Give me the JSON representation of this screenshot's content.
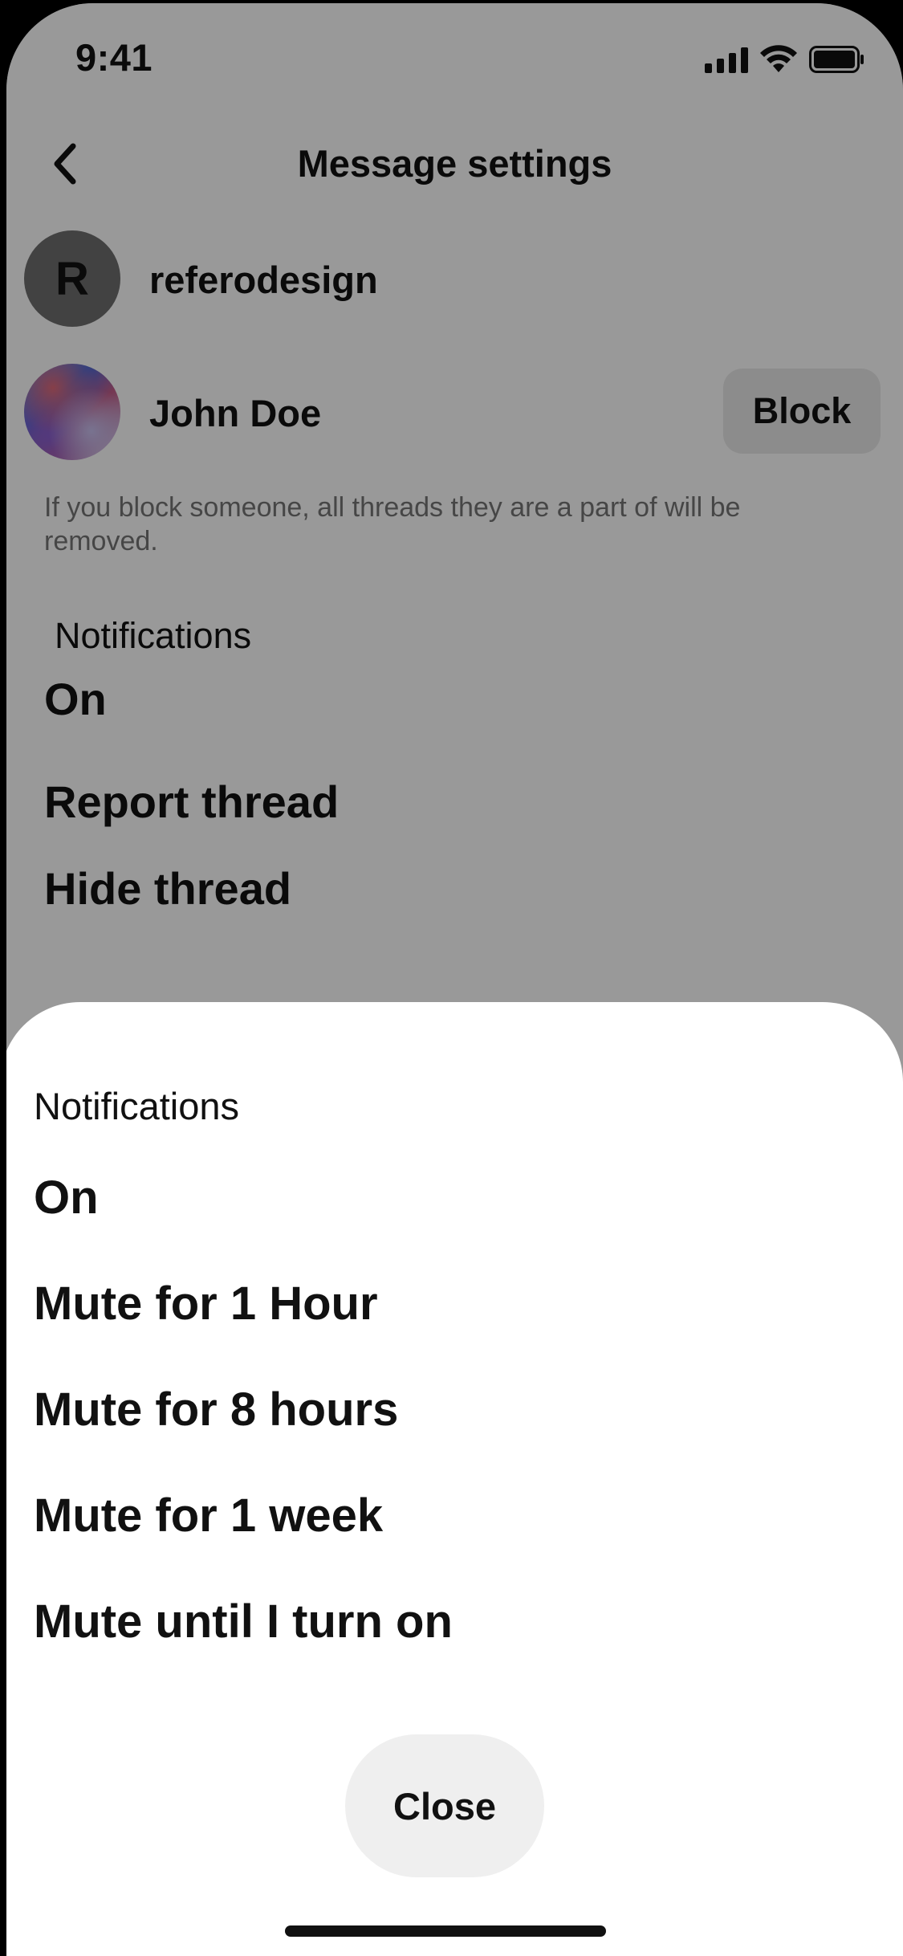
{
  "status_bar": {
    "time": "9:41",
    "icons": [
      "signal-icon",
      "wifi-icon",
      "battery-icon"
    ]
  },
  "nav": {
    "back_icon": "chevron-left-icon",
    "title": "Message settings"
  },
  "participants": [
    {
      "avatar_letter": "R",
      "name": "referodesign"
    },
    {
      "name": "John Doe",
      "action_label": "Block"
    }
  ],
  "block_hint": "If you block someone, all threads they are a part of will be removed.",
  "settings": {
    "notifications_label": "Notifications",
    "notifications_value": "On",
    "report_label": "Report thread",
    "hide_label": "Hide thread"
  },
  "sheet": {
    "title": "Notifications",
    "options": [
      "On",
      "Mute for 1 Hour",
      "Mute for 8 hours",
      "Mute for 1 week",
      "Mute until I turn on"
    ],
    "close_label": "Close"
  },
  "colors": {
    "overlay": "#000000",
    "sheet_background": "#ffffff",
    "button_background": "#efefef",
    "text": "#111111",
    "muted_text": "#767676"
  }
}
